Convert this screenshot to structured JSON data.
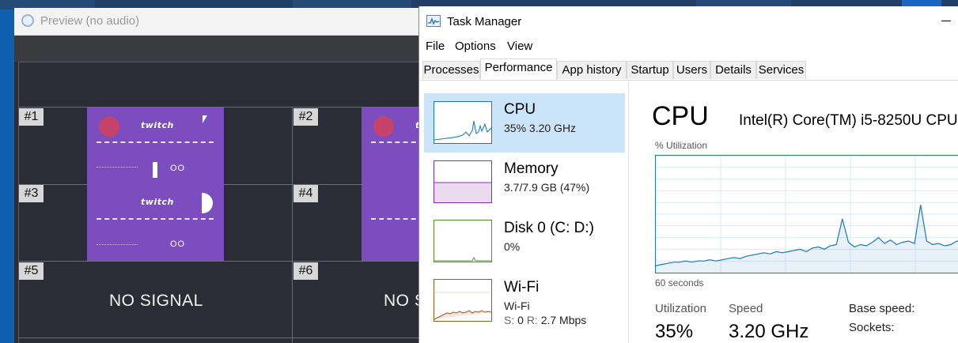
{
  "preview": {
    "title": "Preview (no audio)",
    "tiles": [
      {
        "label": "#1"
      },
      {
        "label": "#2"
      },
      {
        "label": "#3"
      },
      {
        "label": "#4"
      },
      {
        "label": "#5"
      },
      {
        "label": "#6"
      }
    ],
    "no_signal": "NO SIGNAL",
    "no_signal_partial": "NO S",
    "tile_logo": "twitch",
    "tile_oo": "OO"
  },
  "taskmanager": {
    "title": "Task Manager",
    "menu": [
      "File",
      "Options",
      "View"
    ],
    "tabs": [
      "Processes",
      "Performance",
      "App history",
      "Startup",
      "Users",
      "Details",
      "Services"
    ],
    "active_tab": "Performance",
    "sidebar": [
      {
        "name": "CPU",
        "sub": "35%  3.20 GHz",
        "color": "#1a7ab8"
      },
      {
        "name": "Memory",
        "sub": "3.7/7.9 GB (47%)",
        "color": "#8b2fa8"
      },
      {
        "name": "Disk 0 (C: D:)",
        "sub": "0%",
        "color": "#4c9a2a"
      },
      {
        "name": "Wi-Fi",
        "sub": "Wi-Fi",
        "s_label": "S:",
        "s_val": "0",
        "r_label": "R:",
        "r_val": "2.7 Mbps",
        "color": "#a5571c"
      }
    ],
    "main": {
      "title": "CPU",
      "model": "Intel(R) Core(TM) i5-8250U CPU",
      "util_label": "% Utilization",
      "secs_label": "60 seconds",
      "utilization_label": "Utilization",
      "utilization_value": "35%",
      "speed_label": "Speed",
      "speed_value": "3.20 GHz",
      "base_speed_label": "Base speed:",
      "sockets_label": "Sockets:"
    },
    "cpu_history": [
      6,
      7,
      8,
      9,
      9,
      10,
      9,
      10,
      10,
      11,
      10,
      11,
      12,
      13,
      12,
      14,
      15,
      16,
      17,
      16,
      18,
      17,
      18,
      19,
      20,
      18,
      21,
      22,
      20,
      23,
      24,
      46,
      26,
      22,
      24,
      23,
      26,
      30,
      25,
      28,
      24,
      26,
      27,
      25,
      58,
      27,
      24,
      25,
      23,
      24,
      27,
      26
    ]
  }
}
